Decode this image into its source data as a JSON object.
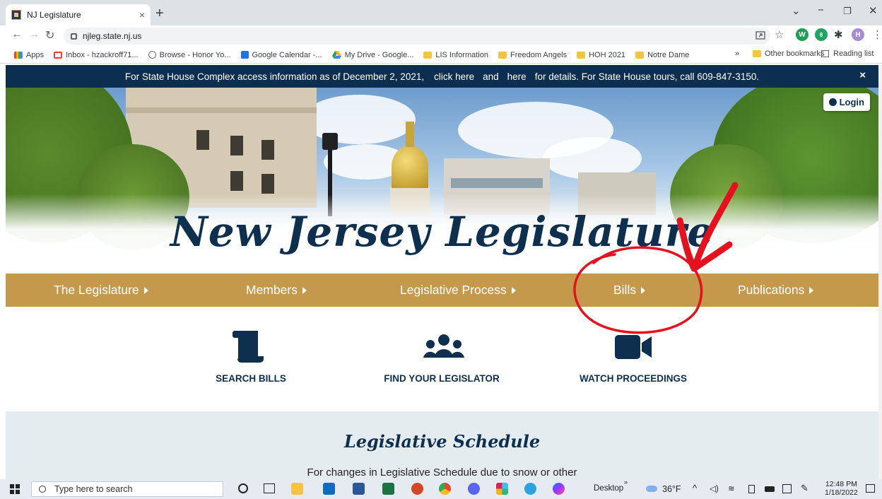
{
  "browser": {
    "tab_title": "NJ Legislature",
    "tab_close": "×",
    "new_tab": "+",
    "url": "njleg.state.nj.us",
    "profile_initial": "H",
    "window_controls": {
      "tab_search": "⌄",
      "minimize": "−",
      "restore": "❐",
      "close": "✕"
    },
    "bookmarks": [
      {
        "label": "Apps",
        "icon": "apps-grid-icon"
      },
      {
        "label": "Inbox - hzackroff71...",
        "icon": "gmail-icon"
      },
      {
        "label": "Browse - Honor Yo...",
        "icon": "globe-icon"
      },
      {
        "label": "Google Calendar -...",
        "icon": "calendar-icon"
      },
      {
        "label": "My Drive - Google...",
        "icon": "drive-icon"
      },
      {
        "label": "LIS Information",
        "icon": "folder-icon"
      },
      {
        "label": "Freedom Angels",
        "icon": "folder-icon"
      },
      {
        "label": "HOH 2021",
        "icon": "folder-icon"
      },
      {
        "label": "Notre Dame",
        "icon": "folder-icon"
      }
    ],
    "bookmarks_overflow": "»",
    "other_bookmarks": "Other bookmarks",
    "reading_list": "Reading list"
  },
  "page": {
    "alert": {
      "text1": "For State House Complex access information as of December 2, 2021,",
      "link1": "click here",
      "and": "and",
      "link2": "here",
      "text2": "for details. For State House tours, call 609-847-3150.",
      "close": "×"
    },
    "login_label": "Login",
    "hero_title": "New Jersey Legislature",
    "nav": [
      "The Legislature",
      "Members",
      "Legislative Process",
      "Bills",
      "Publications"
    ],
    "quick_links": [
      {
        "label": "SEARCH BILLS",
        "icon": "scroll-icon"
      },
      {
        "label": "FIND YOUR LEGISLATOR",
        "icon": "users-icon"
      },
      {
        "label": "WATCH PROCEEDINGS",
        "icon": "video-camera-icon"
      }
    ],
    "schedule_title": "Legislative Schedule",
    "schedule_text": "For changes in Legislative Schedule due to snow or other"
  },
  "taskbar": {
    "search_placeholder": "Type here to search",
    "desktop_label": "Desktop",
    "overflow": "»",
    "weather": "36°F",
    "time": "12:48 PM",
    "date": "1/18/2022"
  },
  "colors": {
    "banner": "#0d2f4f",
    "nav_gold": "#c4994c",
    "brand_navy": "#0f2f4e",
    "annotation_red": "#e3121e"
  }
}
